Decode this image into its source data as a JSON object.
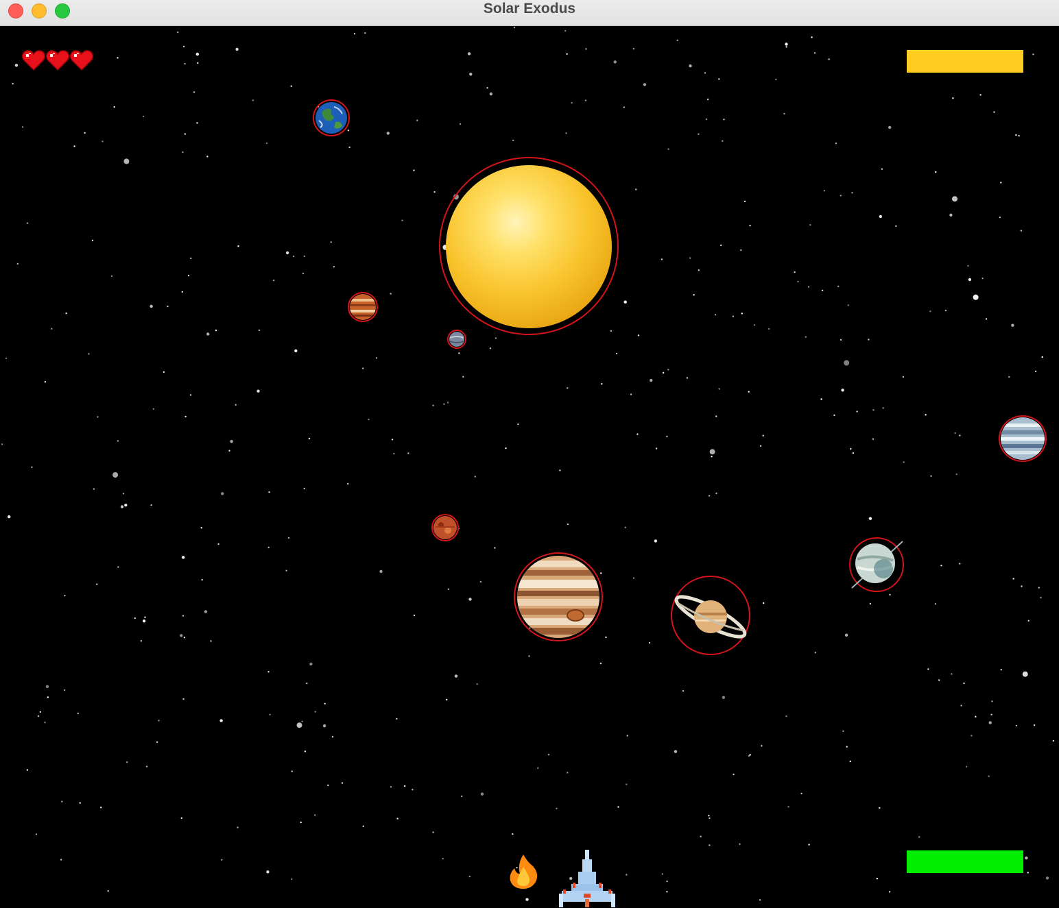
{
  "window": {
    "title": "Solar Exodus"
  },
  "hud": {
    "lives": 3,
    "bars": {
      "top": {
        "color": "#ffcc22",
        "name": "yellow-status-bar"
      },
      "bottom": {
        "color": "#00ee00",
        "name": "green-status-bar"
      }
    }
  },
  "colors": {
    "hitbox": "#d4141a",
    "heart": "#e8101a",
    "background": "#000000"
  },
  "bodies": [
    {
      "name": "sun",
      "icon": "sun-icon"
    },
    {
      "name": "earth",
      "icon": "earth-icon"
    },
    {
      "name": "mars-like-planet",
      "icon": "planet-icon"
    },
    {
      "name": "mercury-like-planet",
      "icon": "planet-icon"
    },
    {
      "name": "small-red-planet",
      "icon": "planet-icon"
    },
    {
      "name": "jupiter",
      "icon": "jupiter-icon"
    },
    {
      "name": "saturn",
      "icon": "saturn-icon"
    },
    {
      "name": "uranus",
      "icon": "uranus-icon"
    },
    {
      "name": "neptune",
      "icon": "neptune-icon"
    }
  ],
  "player": {
    "ship_icon": "spaceship-icon",
    "projectile_icon": "fire-icon"
  }
}
